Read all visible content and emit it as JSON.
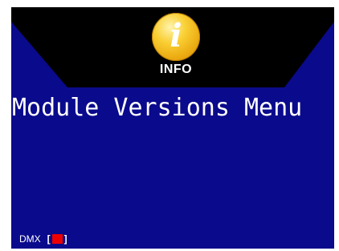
{
  "header": {
    "icon": "info-icon",
    "icon_glyph": "i",
    "label": "INFO"
  },
  "main": {
    "title": "Module Versions Menu"
  },
  "status": {
    "dmx_label": "DMX",
    "bracket_open": "[",
    "bracket_close": "]",
    "dmx_indicator_color": "#ee0000"
  },
  "colors": {
    "background": "#0a0a8c",
    "header_band": "#000000",
    "accent": "#f9cf33"
  }
}
